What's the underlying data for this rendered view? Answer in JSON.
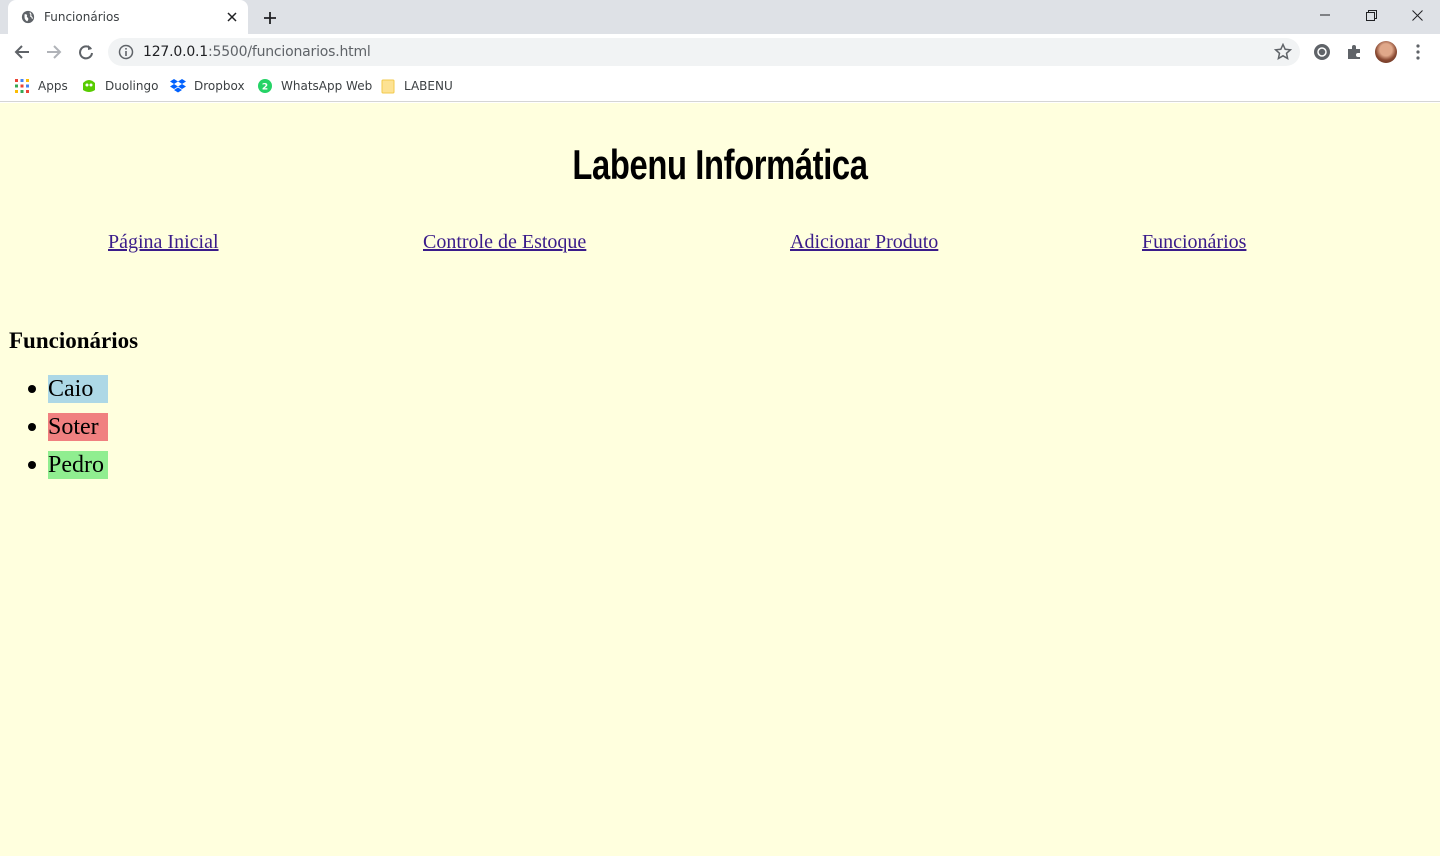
{
  "browser": {
    "tab_title": "Funcionários",
    "url_host": "127.0.0.1",
    "url_path": ":5500/funcionarios.html",
    "bookmarks": [
      {
        "label": "Apps",
        "icon": "apps-grid-icon"
      },
      {
        "label": "Duolingo",
        "icon": "duolingo-icon"
      },
      {
        "label": "Dropbox",
        "icon": "dropbox-icon"
      },
      {
        "label": "WhatsApp Web",
        "icon": "whatsapp-icon"
      },
      {
        "label": "LABENU",
        "icon": "folder-icon"
      }
    ]
  },
  "page": {
    "title": "Labenu Informática",
    "nav": [
      {
        "label": "Página Inicial"
      },
      {
        "label": "Controle de Estoque"
      },
      {
        "label": "Adicionar Produto"
      },
      {
        "label": "Funcionários"
      }
    ],
    "section_title": "Funcionários",
    "employees": [
      {
        "name": "Caio",
        "color": "#add8e6"
      },
      {
        "name": "Soter",
        "color": "#f08080"
      },
      {
        "name": "Pedro",
        "color": "#90ee90"
      }
    ]
  },
  "colors": {
    "page_background": "#ffffde",
    "link": "#3a1c8a"
  }
}
